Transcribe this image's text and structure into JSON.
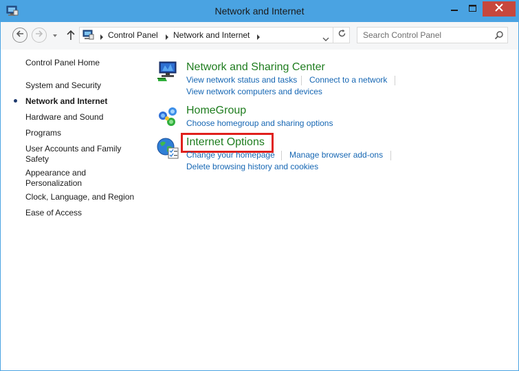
{
  "window": {
    "title": "Network and Internet",
    "icon": "control-panel-icon"
  },
  "title_controls": {
    "minimize_icon": "minimize-icon",
    "maximize_icon": "maximize-icon",
    "close_icon": "close-icon",
    "close_color": "#c7473c"
  },
  "navigation": {
    "back_icon": "back-arrow-icon",
    "forward_icon": "forward-arrow-icon",
    "recent_icon": "chevron-down-icon",
    "up_icon": "up-arrow-icon"
  },
  "address_bar": {
    "icon": "control-panel-icon",
    "breadcrumbs": [
      "Control Panel",
      "Network and Internet"
    ],
    "refresh_icon": "refresh-icon"
  },
  "search": {
    "placeholder": "Search Control Panel",
    "icon": "search-icon"
  },
  "sidebar": {
    "home": "Control Panel Home",
    "items": [
      {
        "label": "System and Security",
        "current": false
      },
      {
        "label": "Network and Internet",
        "current": true
      },
      {
        "label": "Hardware and Sound",
        "current": false
      },
      {
        "label": "Programs",
        "current": false
      },
      {
        "label": "User Accounts and Family Safety",
        "current": false
      },
      {
        "label": "Appearance and Personalization",
        "current": false
      },
      {
        "label": "Clock, Language, and Region",
        "current": false
      },
      {
        "label": "Ease of Access",
        "current": false
      }
    ]
  },
  "categories": [
    {
      "title": "Network and Sharing Center",
      "icon": "network-sharing-icon",
      "links": [
        "View network status and tasks",
        "Connect to a network",
        "View network computers and devices"
      ]
    },
    {
      "title": "HomeGroup",
      "icon": "homegroup-icon",
      "links": [
        "Choose homegroup and sharing options"
      ]
    },
    {
      "title": "Internet Options",
      "icon": "internet-options-icon",
      "highlighted": true,
      "links": [
        "Change your homepage",
        "Manage browser add-ons",
        "Delete browsing history and cookies"
      ]
    }
  ],
  "colors": {
    "title_bar": "#4aa3e2",
    "category_title": "#1f7d1f",
    "task_link": "#1566b3",
    "highlight": "#e0201c"
  }
}
